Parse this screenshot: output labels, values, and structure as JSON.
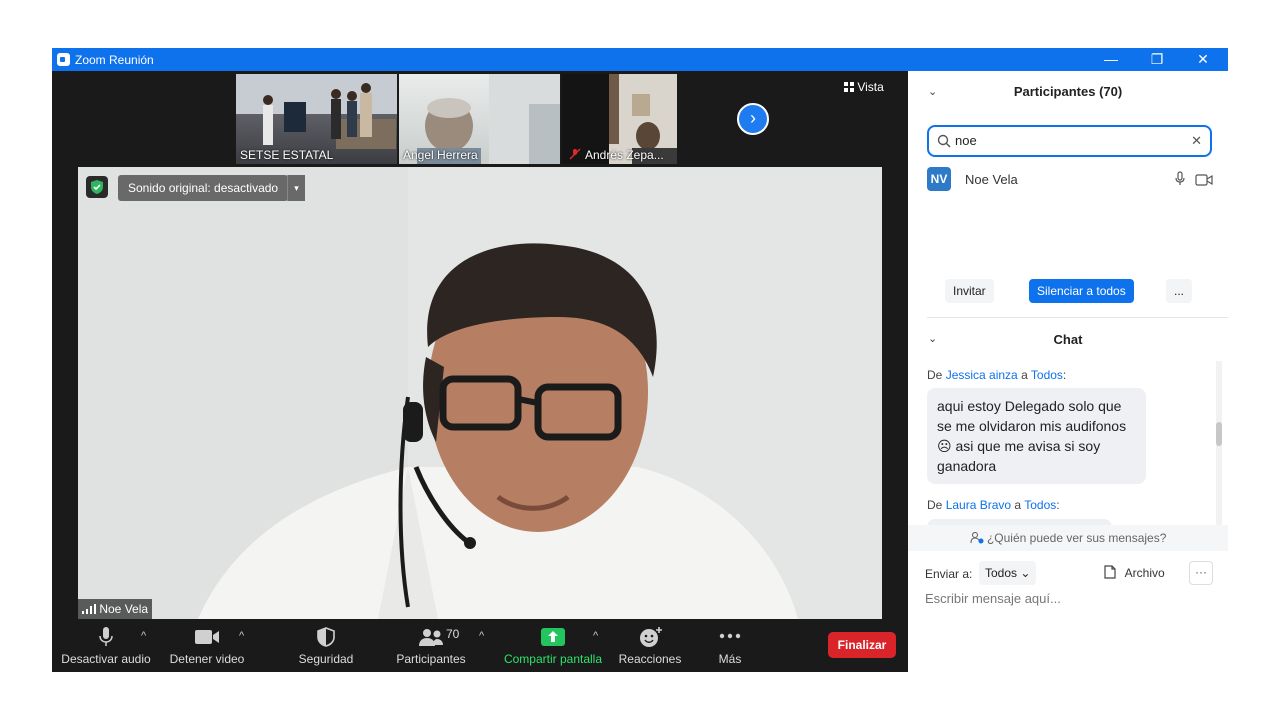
{
  "window": {
    "title": "Zoom Reunión",
    "minimize": "—",
    "restore": "❐",
    "close": "✕"
  },
  "gallery": {
    "thumbnails": [
      {
        "name": "SETSE ESTATAL"
      },
      {
        "name": "Angel Herrera"
      },
      {
        "name": "Andrés Zepa..."
      }
    ],
    "next_arrow": "›",
    "vista_label": "Vista"
  },
  "main_video": {
    "sound_label": "Sonido original: desactivado",
    "sound_dropdown": "▾",
    "speaker_name": "Noe Vela"
  },
  "toolbar": {
    "mute_label": "Desactivar audio",
    "video_label": "Detener video",
    "security_label": "Seguridad",
    "participants_label": "Participantes",
    "participants_count": "70",
    "share_label": "Compartir pantalla",
    "reactions_label": "Reacciones",
    "more_label": "Más",
    "caret": "^",
    "end_label": "Finalizar"
  },
  "participants_panel": {
    "header": "Participantes (70)",
    "chevron": "⌄",
    "search_value": "noe",
    "search_clear": "✕",
    "results": [
      {
        "initials": "NV",
        "name": "Noe Vela"
      }
    ],
    "invite_label": "Invitar",
    "mute_all_label": "Silenciar a todos",
    "more_label": "..."
  },
  "chat_panel": {
    "header": "Chat",
    "chevron": "⌄",
    "messages": [
      {
        "from_prefix": "De",
        "sender": "Jessica ainza",
        "to_word": "a",
        "recipient": "Todos",
        "colon": ":",
        "text": "aqui estoy Delegado solo que se me olvidaron mis audifonos ☹ asi que me avisa si soy ganadora"
      },
      {
        "from_prefix": "De",
        "sender": "Laura Bravo",
        "to_word": "a",
        "recipient": "Todos",
        "colon": ":"
      }
    ],
    "who_can_see": "¿Quién puede ver sus mensajes?",
    "send_to_label": "Enviar a:",
    "send_to_value": "Todos",
    "send_to_caret": "⌄",
    "file_label": "Archivo",
    "more_label": "···",
    "input_placeholder": "Escribir mensaje aquí..."
  },
  "colors": {
    "zoom_blue": "#0e72ed",
    "end_red": "#d9252a",
    "share_green": "#22c55e",
    "toolbar_bg": "#1a1a1a"
  }
}
